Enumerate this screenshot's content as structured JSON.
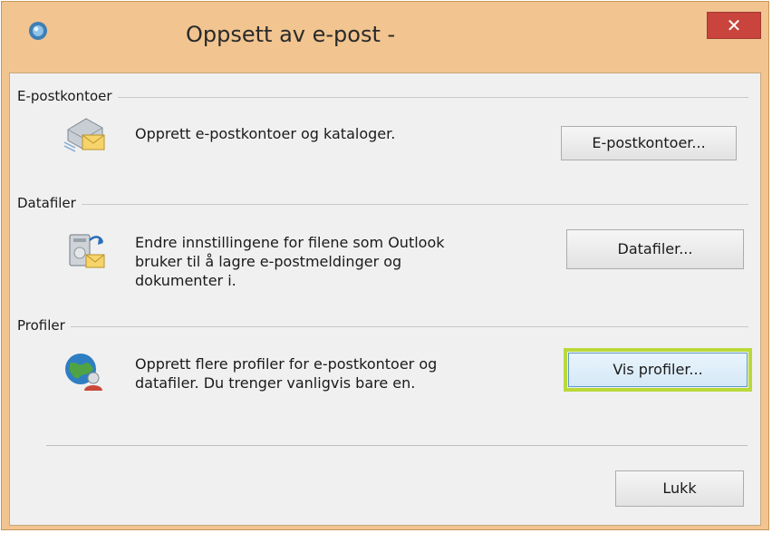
{
  "window": {
    "title": "Oppsett av e-post -",
    "close_label": "✕"
  },
  "groups": {
    "accounts": {
      "label": "E-postkontoer",
      "description": "Opprett e-postkontoer og kataloger.",
      "button_label": "E-postkontoer...",
      "icon": "mail-account-icon"
    },
    "datafiles": {
      "label": "Datafiler",
      "description_lines": [
        "Endre innstillingene for filene som Outlook",
        "bruker til å lagre e-postmeldinger og",
        "dokumenter i."
      ],
      "button_label": "Datafiler...",
      "icon": "data-files-icon"
    },
    "profiles": {
      "label": "Profiler",
      "description_lines": [
        "Opprett flere profiler for e-postkontoer og",
        "datafiler. Du trenger vanligvis bare en."
      ],
      "button_label": "Vis profiler...",
      "icon": "profiles-globe-icon"
    }
  },
  "footer": {
    "close_button_label": "Lukk"
  },
  "colors": {
    "title_bar": "#f1c490",
    "close_button": "#c8443c",
    "focus_highlight": "#b9d93a",
    "dialog_bg": "#f0f0f0"
  }
}
